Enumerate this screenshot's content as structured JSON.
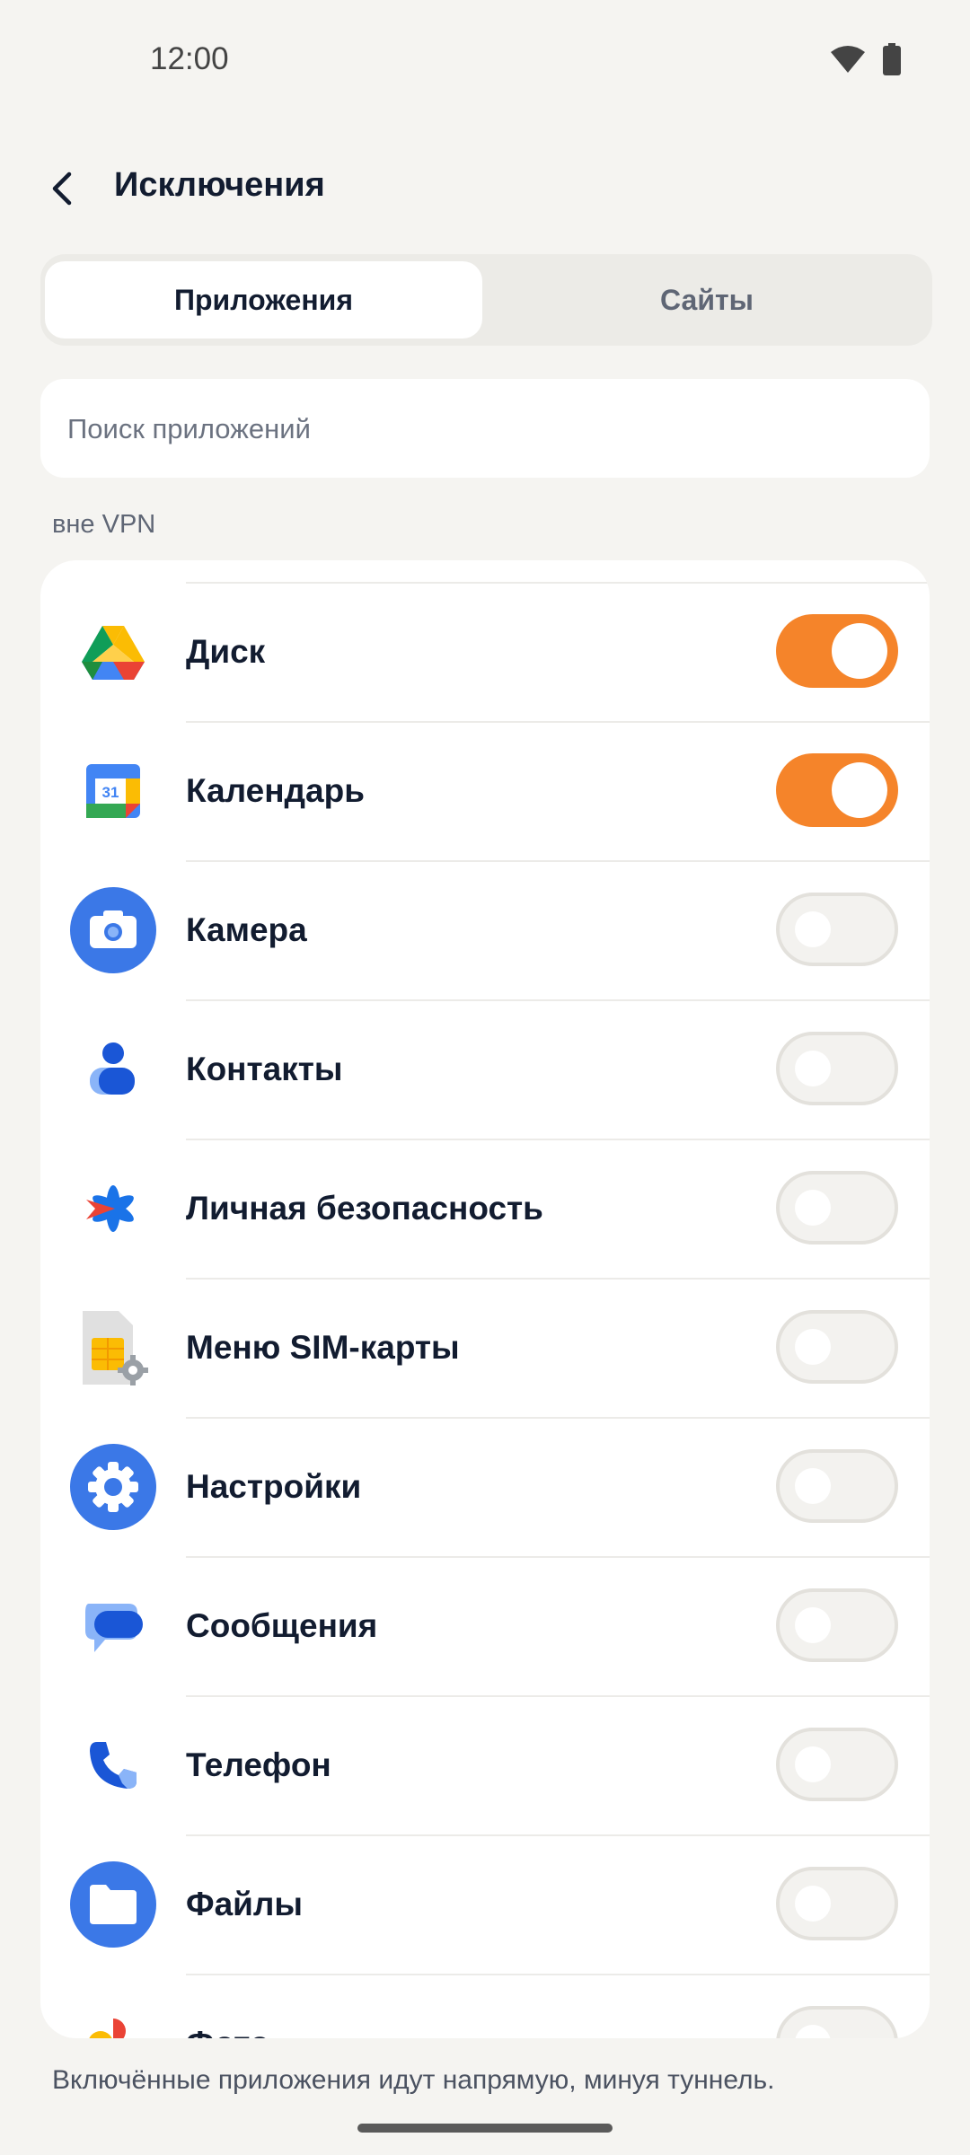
{
  "status_bar": {
    "time": "12:00"
  },
  "header": {
    "title": "Исключения"
  },
  "tabs": [
    {
      "label": "Приложения",
      "active": true
    },
    {
      "label": "Сайты",
      "active": false
    }
  ],
  "search": {
    "placeholder": "Поиск приложений",
    "value": ""
  },
  "section_label": "вне VPN",
  "apps": [
    {
      "name": "Диск",
      "icon": "google-drive-icon",
      "enabled": true
    },
    {
      "name": "Календарь",
      "icon": "google-calendar-icon",
      "enabled": true
    },
    {
      "name": "Камера",
      "icon": "camera-icon",
      "enabled": false
    },
    {
      "name": "Контакты",
      "icon": "contacts-icon",
      "enabled": false
    },
    {
      "name": "Личная безопасность",
      "icon": "personal-safety-icon",
      "enabled": false
    },
    {
      "name": "Меню SIM-карты",
      "icon": "sim-card-icon",
      "enabled": false
    },
    {
      "name": "Настройки",
      "icon": "settings-icon",
      "enabled": false
    },
    {
      "name": "Сообщения",
      "icon": "messages-icon",
      "enabled": false
    },
    {
      "name": "Телефон",
      "icon": "phone-icon",
      "enabled": false
    },
    {
      "name": "Файлы",
      "icon": "files-icon",
      "enabled": false
    },
    {
      "name": "Фото",
      "icon": "photos-icon",
      "enabled": false
    }
  ],
  "calendar_day": "31",
  "footer_note": "Включённые приложения идут напрямую, минуя туннель.",
  "colors": {
    "accent": "#f5842a",
    "background": "#f5f4f1",
    "text": "#121c30"
  }
}
